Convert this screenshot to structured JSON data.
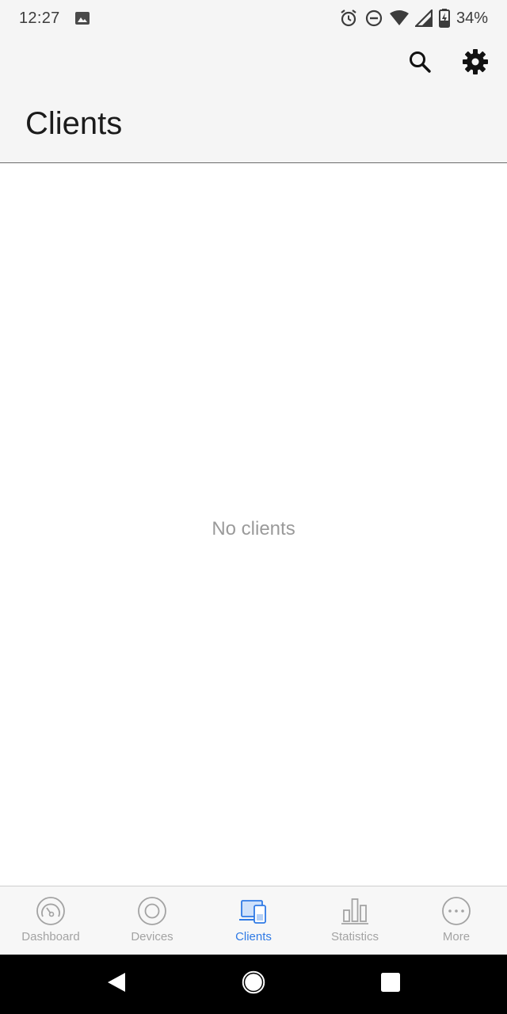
{
  "status_bar": {
    "time": "12:27",
    "battery_percent": "34%",
    "icons": [
      "image-icon",
      "alarm-icon",
      "do-not-disturb-icon",
      "wifi-icon",
      "signal-icon",
      "battery-charging-icon"
    ]
  },
  "app_bar": {
    "title": "Clients",
    "actions": [
      "search-icon",
      "settings-icon"
    ]
  },
  "content": {
    "empty_message": "No clients"
  },
  "bottom_nav": {
    "active_color": "#2f7ae5",
    "inactive_color": "#a3a3a3",
    "items": [
      {
        "label": "Dashboard",
        "icon": "dashboard-gauge-icon",
        "active": false
      },
      {
        "label": "Devices",
        "icon": "devices-ring-icon",
        "active": false
      },
      {
        "label": "Clients",
        "icon": "clients-devices-icon",
        "active": true
      },
      {
        "label": "Statistics",
        "icon": "bar-chart-icon",
        "active": false
      },
      {
        "label": "More",
        "icon": "more-dots-icon",
        "active": false
      }
    ]
  },
  "system_nav": {
    "buttons": [
      "back-icon",
      "home-icon",
      "recents-icon"
    ]
  }
}
